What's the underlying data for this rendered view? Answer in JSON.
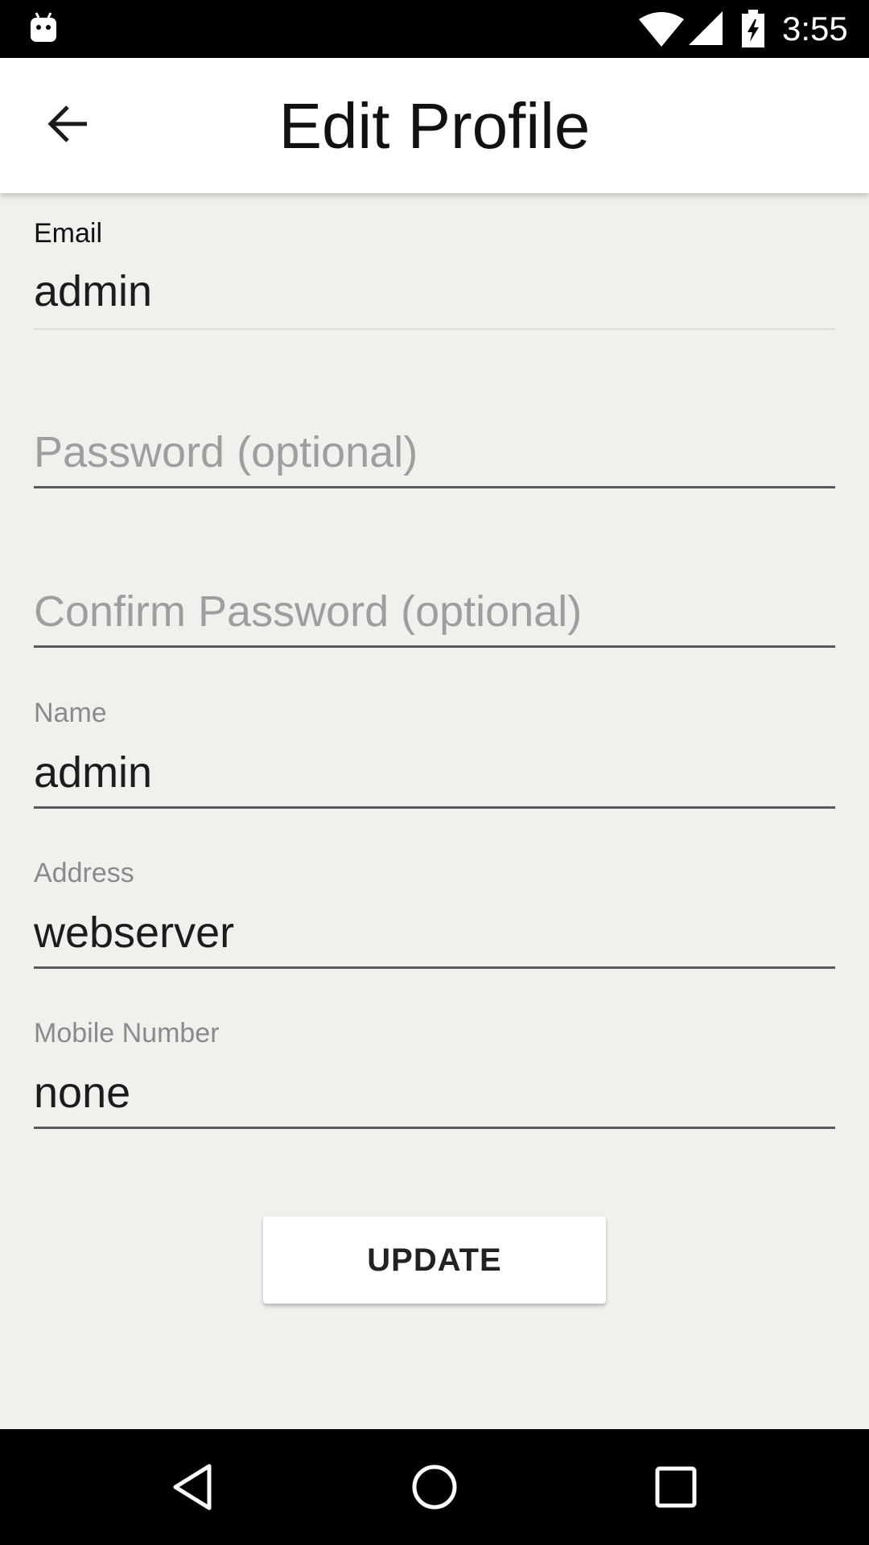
{
  "status_bar": {
    "time": "3:55",
    "icons": [
      "android-debug-icon",
      "wifi-icon",
      "signal-icon",
      "battery-charging-icon"
    ]
  },
  "app_bar": {
    "title": "Edit Profile",
    "back_icon": "arrow-back-icon"
  },
  "form": {
    "email": {
      "label": "Email",
      "value": "admin"
    },
    "password": {
      "placeholder": "Password (optional)",
      "value": ""
    },
    "confirm_password": {
      "placeholder": "Confirm Password (optional)",
      "value": ""
    },
    "name": {
      "label": "Name",
      "value": "admin"
    },
    "address": {
      "label": "Address",
      "value": "webserver"
    },
    "mobile": {
      "label": "Mobile Number",
      "value": "none"
    },
    "update_label": "UPDATE"
  },
  "nav_bar": {
    "icons": [
      "nav-back-icon",
      "nav-home-icon",
      "nav-recents-icon"
    ]
  },
  "colors": {
    "background": "#f1f0ed",
    "app_bar": "#ffffff",
    "underline": "#5a5a5a",
    "floating_label": "#8a8a8a",
    "placeholder": "#9e9e9e"
  }
}
